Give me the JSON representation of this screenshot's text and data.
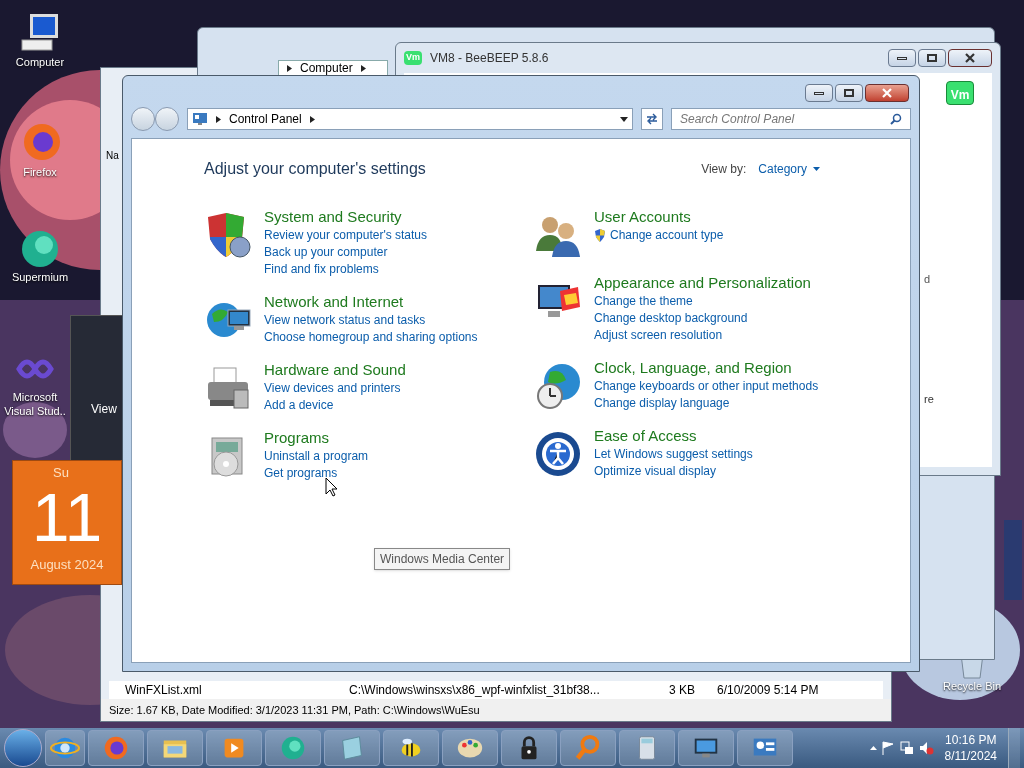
{
  "desktop_icons": [
    {
      "label": "Computer"
    },
    {
      "label": "Firefox"
    },
    {
      "label": "Supermium"
    },
    {
      "label": "Microsoft Visual Stud.."
    },
    {
      "label": "Recycle Bin"
    }
  ],
  "calendar_gadget": {
    "day_name": "Su",
    "day": "11",
    "month": "August 2024"
  },
  "dark_window": {
    "label": "View"
  },
  "explorer_window": {
    "breadcrumb": "Computer"
  },
  "beebeep_window": {
    "title": "VM8 - BeeBEEP 5.8.6",
    "logos": [
      "Vm",
      "Vm"
    ],
    "fragments": [
      "d",
      "re"
    ]
  },
  "file_list_window": {
    "column": "Na",
    "row": {
      "name": "WinFXList.xml",
      "path": "C:\\Windows\\winsxs\\x86_wpf-winfxlist_31bf38...",
      "size": "3 KB",
      "date": "6/10/2009 5:14 PM"
    },
    "status": "Size: 1.67 KB, Date Modified: 3/1/2023 11:31 PM, Path: C:\\Windows\\WuEsu"
  },
  "control_panel": {
    "breadcrumb": "Control Panel",
    "search": {
      "placeholder": "Search Control Panel"
    },
    "heading": "Adjust your computer's settings",
    "view_by": {
      "label": "View by:",
      "value": "Category"
    },
    "columns": [
      [
        {
          "title": "System and Security",
          "links": [
            {
              "text": "Review your computer's status",
              "shield": false
            },
            {
              "text": "Back up your computer",
              "shield": false
            },
            {
              "text": "Find and fix problems",
              "shield": false
            }
          ]
        },
        {
          "title": "Network and Internet",
          "links": [
            {
              "text": "View network status and tasks",
              "shield": false
            },
            {
              "text": "Choose homegroup and sharing options",
              "shield": false
            }
          ]
        },
        {
          "title": "Hardware and Sound",
          "links": [
            {
              "text": "View devices and printers",
              "shield": false
            },
            {
              "text": "Add a device",
              "shield": false
            }
          ]
        },
        {
          "title": "Programs",
          "links": [
            {
              "text": "Uninstall a program",
              "shield": false
            },
            {
              "text": "Get programs",
              "shield": false
            }
          ]
        }
      ],
      [
        {
          "title": "User Accounts",
          "links": [
            {
              "text": "Change account type",
              "shield": true
            }
          ]
        },
        {
          "title": "Appearance and Personalization",
          "links": [
            {
              "text": "Change the theme",
              "shield": false
            },
            {
              "text": "Change desktop background",
              "shield": false
            },
            {
              "text": "Adjust screen resolution",
              "shield": false
            }
          ]
        },
        {
          "title": "Clock, Language, and Region",
          "links": [
            {
              "text": "Change keyboards or other input methods",
              "shield": false
            },
            {
              "text": "Change display language",
              "shield": false
            }
          ]
        },
        {
          "title": "Ease of Access",
          "links": [
            {
              "text": "Let Windows suggest settings",
              "shield": false
            },
            {
              "text": "Optimize visual display",
              "shield": false
            }
          ]
        }
      ]
    ]
  },
  "tooltip": "Windows Media Center",
  "taskbar": {
    "clock": {
      "time": "10:16 PM",
      "date": "8/11/2024"
    }
  }
}
